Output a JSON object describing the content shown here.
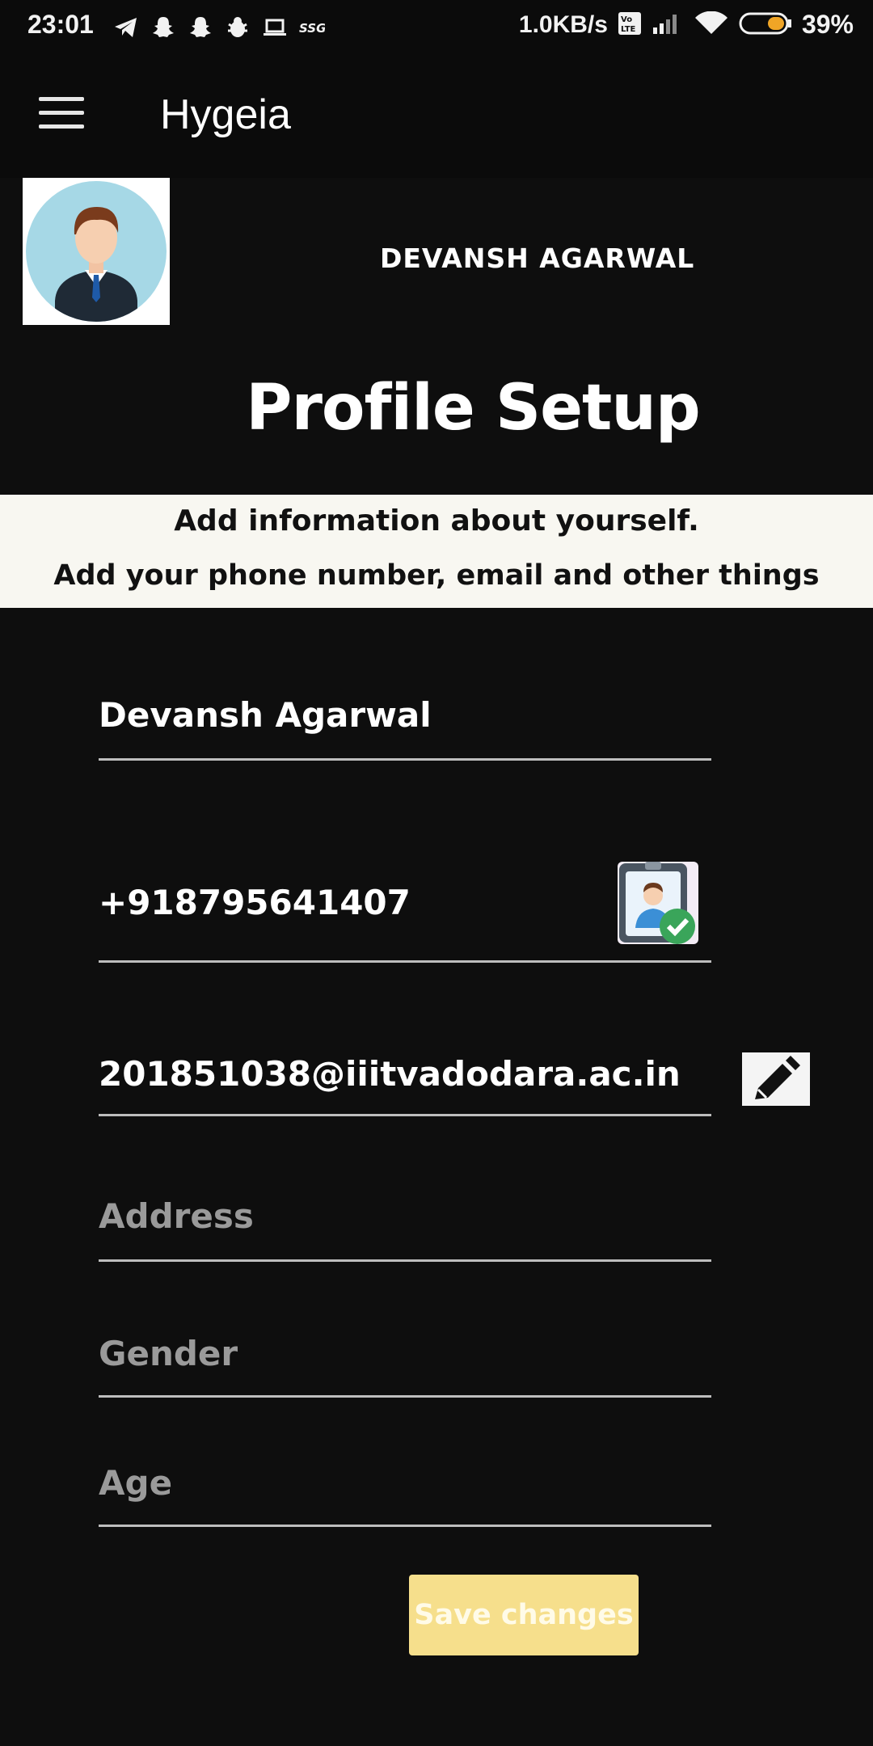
{
  "status_bar": {
    "time": "23:01",
    "network_speed": "1.0KB/s",
    "battery_percent": "39%",
    "notification_icons": [
      "telegram-icon",
      "snapchat-icon",
      "snapchat-icon",
      "bug-icon",
      "laptop-icon",
      "ssg-icon"
    ],
    "system_icons": [
      "volte-icon",
      "signal-icon",
      "wifi-icon",
      "battery-icon"
    ]
  },
  "app_bar": {
    "title": "Hygeia",
    "menu_icon": "hamburger-menu-icon"
  },
  "profile": {
    "name": "DEVANSH AGARWAL",
    "avatar_icon": "user-avatar-icon"
  },
  "page": {
    "title": "Profile Setup",
    "banner_line1": "Add information about yourself.",
    "banner_line2": "Add your phone number, email and other things"
  },
  "form": {
    "name_value": "Devansh Agarwal",
    "phone_value": "+918795641407",
    "email_value": "201851038@iiitvadodara.ac.in",
    "address_placeholder": "Address",
    "gender_placeholder": "Gender",
    "age_placeholder": "Age",
    "save_label": "Save changes"
  },
  "colors": {
    "background": "#0e0e0e",
    "banner": "#f8f7f1",
    "save_button": "#f6df8c",
    "underline": "#bdbdbd"
  }
}
